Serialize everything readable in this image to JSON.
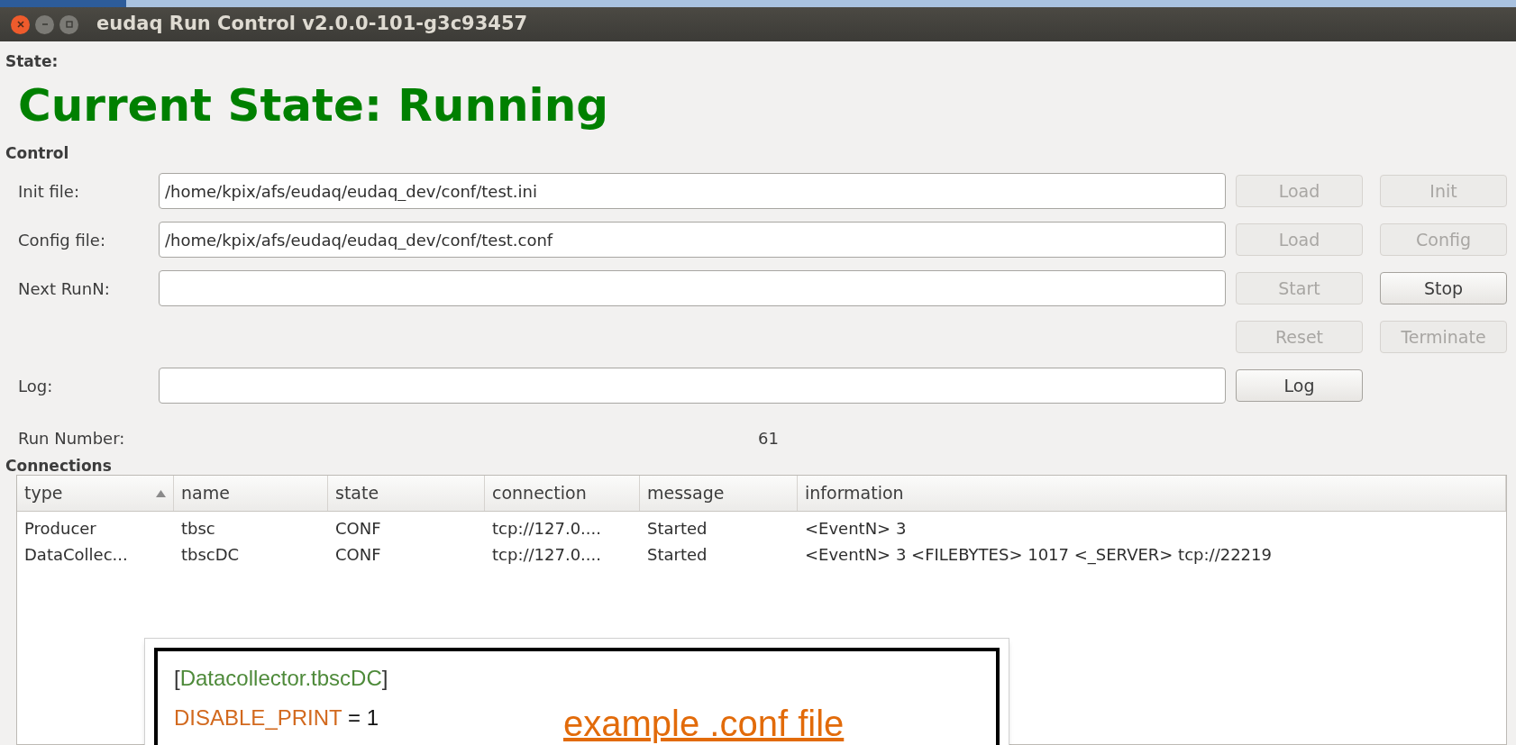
{
  "window": {
    "title": "eudaq Run Control v2.0.0-101-g3c93457"
  },
  "state": {
    "label": "State:",
    "text": "Current State: Running"
  },
  "control": {
    "label": "Control",
    "rows": [
      {
        "label": "Init file:",
        "value": "/home/kpix/afs/eudaq/eudaq_dev/conf/test.ini",
        "buttons": [
          {
            "label": "Load",
            "disabled": true
          },
          {
            "label": "Init",
            "disabled": true
          }
        ]
      },
      {
        "label": "Config file:",
        "value": "/home/kpix/afs/eudaq/eudaq_dev/conf/test.conf",
        "buttons": [
          {
            "label": "Load",
            "disabled": true
          },
          {
            "label": "Config",
            "disabled": true
          }
        ]
      },
      {
        "label": "Next RunN:",
        "buttons": [
          {
            "label": "Start",
            "disabled": true
          },
          {
            "label": "Stop",
            "disabled": false
          }
        ]
      },
      {
        "buttons": [
          {
            "label": "Reset",
            "disabled": true
          },
          {
            "label": "Terminate",
            "disabled": true
          }
        ]
      },
      {
        "label": "Log:",
        "buttons": [
          {
            "label": "Log",
            "disabled": false
          }
        ]
      }
    ],
    "run_number": {
      "label": "Run Number:",
      "value": "61"
    }
  },
  "connections": {
    "label": "Connections",
    "columns": [
      {
        "label": "type",
        "sorted": true
      },
      {
        "label": "name",
        "sorted": false
      },
      {
        "label": "state",
        "sorted": false
      },
      {
        "label": "connection",
        "sorted": false
      },
      {
        "label": "message",
        "sorted": false
      },
      {
        "label": "information",
        "sorted": false
      }
    ],
    "rows": [
      [
        "Producer",
        "tbsc",
        "CONF",
        "tcp://127.0....",
        "Started",
        "<EventN> 3"
      ],
      [
        "DataCollec...",
        "tbscDC",
        "CONF",
        "tcp://127.0....",
        "Started",
        "<EventN> 3  <FILEBYTES> 1017  <_SERVER> tcp://22219"
      ]
    ]
  },
  "annotation": {
    "caption": "example .conf file",
    "lines": [
      [
        {
          "text": "[",
          "color": "#333333"
        },
        {
          "text": "Datacollector.tbscDC",
          "color": "#4e8a3a"
        },
        {
          "text": "]",
          "color": "#333333"
        }
      ],
      [
        {
          "text": "DISABLE_PRINT",
          "color": "#d2691e"
        },
        {
          "text": " = 1",
          "color": "#111111"
        }
      ]
    ]
  }
}
